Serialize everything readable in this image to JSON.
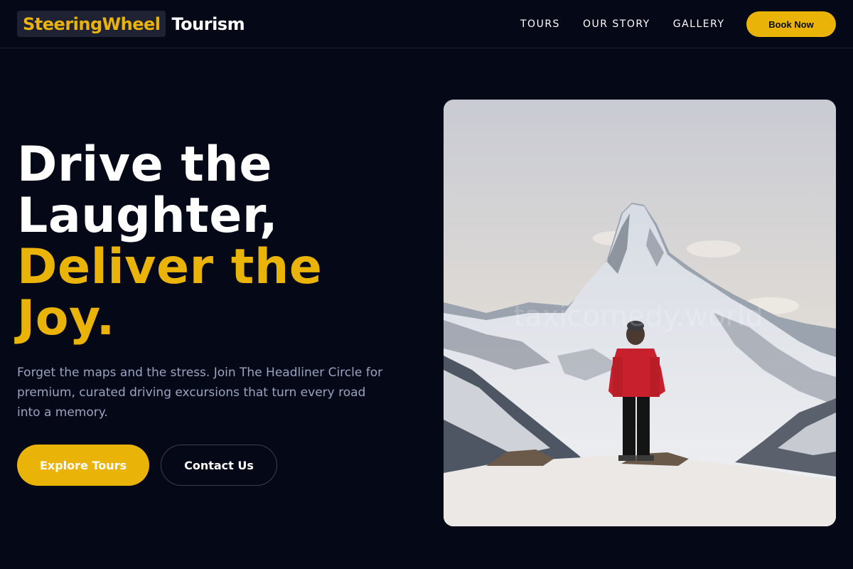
{
  "brand": {
    "highlight": "SteeringWheel",
    "word": "Tourism"
  },
  "nav": {
    "items": [
      {
        "label": "TOURS"
      },
      {
        "label": "OUR STORY"
      },
      {
        "label": "GALLERY"
      }
    ],
    "cta_label": "Book Now"
  },
  "hero": {
    "title_lines": [
      "Drive the",
      "Laughter,"
    ],
    "accent_lines": [
      "Deliver the",
      "Joy."
    ],
    "subtitle": "Forget the maps and the stress. Join The Headliner Circle for premium, curated driving excursions that turn every road into a memory.",
    "primary_button": "Explore Tours",
    "secondary_button": "Contact Us",
    "image_watermark": "taxicomedy.world"
  },
  "colors": {
    "accent": "#eab308",
    "background": "#050816",
    "muted_text": "#9aa3bf"
  }
}
